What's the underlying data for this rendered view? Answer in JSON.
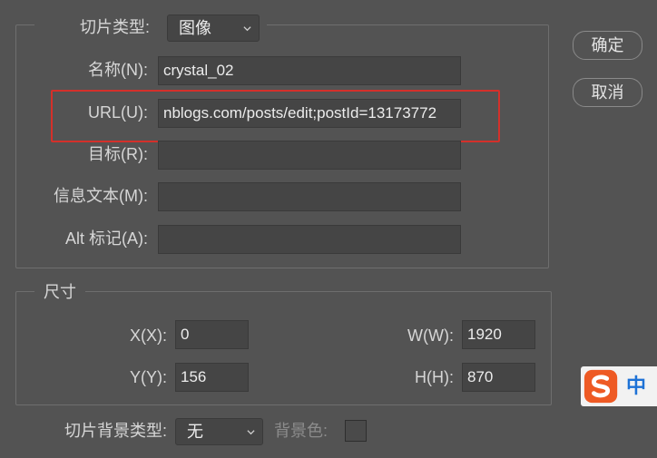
{
  "slice": {
    "type_label": "切片类型:",
    "type_value": "图像",
    "fields": [
      {
        "label": "名称(N):",
        "value": "crystal_02"
      },
      {
        "label": "URL(U):",
        "value": "nblogs.com/posts/edit;postId=13173772"
      },
      {
        "label": "目标(R):",
        "value": ""
      },
      {
        "label": "信息文本(M):",
        "value": ""
      },
      {
        "label": "Alt 标记(A):",
        "value": ""
      }
    ]
  },
  "dimensions": {
    "title": "尺寸",
    "x_label": "X(X):",
    "x_value": "0",
    "y_label": "Y(Y):",
    "y_value": "156",
    "w_label": "W(W):",
    "w_value": "1920",
    "h_label": "H(H):",
    "h_value": "870"
  },
  "background": {
    "type_label": "切片背景类型:",
    "type_value": "无",
    "color_label": "背景色:"
  },
  "buttons": {
    "ok": "确定",
    "cancel": "取消"
  },
  "ime": {
    "mode": "中"
  },
  "colors": {
    "dialog_bg": "#535353",
    "field_bg": "#454545",
    "highlight": "#d4302a",
    "ime_logo": "#ee5a24",
    "ime_text": "#1e72d6"
  }
}
